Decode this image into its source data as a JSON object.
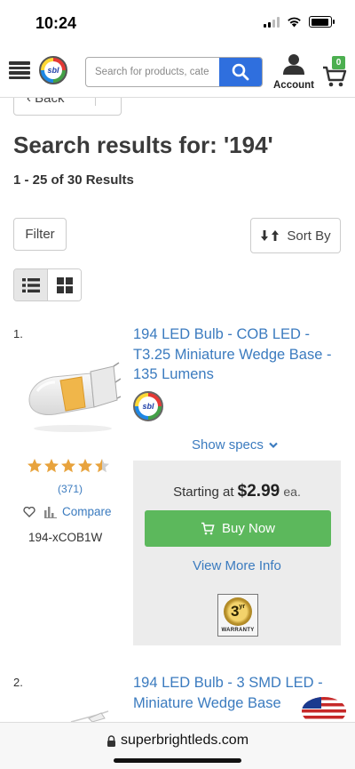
{
  "status_bar": {
    "time": "10:24"
  },
  "header": {
    "logo_text": "sbl",
    "search_placeholder": "Search for products, cate",
    "account_label": "Account",
    "cart_count": "0"
  },
  "nav": {
    "back_label": "Back"
  },
  "results": {
    "title": "Search results for: '194'",
    "count": "1 - 25 of 30 Results"
  },
  "controls": {
    "filter_label": "Filter",
    "sort_label": "Sort By"
  },
  "products": [
    {
      "index": "1.",
      "title": "194 LED Bulb - COB LED - T3.25 Miniature Wedge Base - 135 Lumens",
      "brand_logo_text": "sbl",
      "show_specs": "Show specs",
      "rating": 4.5,
      "review_count": "(371)",
      "compare_label": "Compare",
      "sku": "194-xCOB1W",
      "price_prefix": "Starting at",
      "price": "$2.99",
      "price_unit": "ea.",
      "buy_label": "Buy Now",
      "more_info_label": "View More Info",
      "warranty_years": "3",
      "warranty_years_suffix": "yr",
      "warranty_label": "WARRANTY"
    },
    {
      "index": "2.",
      "title": "194 LED Bulb - 3 SMD LED - Miniature Wedge Base"
    }
  ],
  "url_bar": {
    "domain": "superbrightleds.com"
  },
  "colors": {
    "link": "#3b7bbf",
    "search_button": "#2f6fde",
    "buy_button": "#5cb85c",
    "cart_badge": "#4caf50",
    "star": "#e8a33d"
  }
}
